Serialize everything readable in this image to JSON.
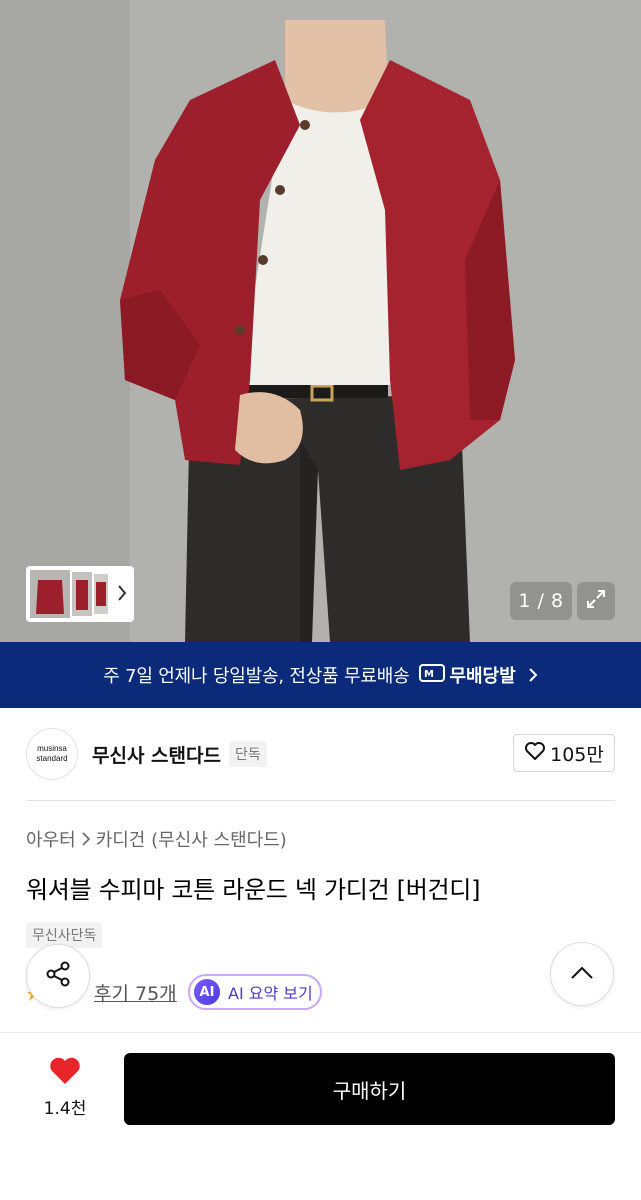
{
  "gallery": {
    "counter": "1 / 8",
    "thumbnail_strip": "product-thumbnails",
    "expand_icon": "expand-icon",
    "chevron_icon": "chevron-right-icon"
  },
  "banner": {
    "text": "주 7일 언제나 당일발송, 전상품 무료배송",
    "badge_label": "무배당발",
    "badge_icon": "delivery-badge-icon",
    "chevron_icon": "chevron-right-icon",
    "background_color": "#0b2a7a"
  },
  "brand": {
    "logo_line1": "musinsa",
    "logo_line2": "standard",
    "name": "무신사 스탠다드",
    "tag": "단독",
    "like_count": "105만",
    "like_icon": "heart-outline-icon"
  },
  "product": {
    "breadcrumb": [
      "아우터",
      "카디건 (무신사 스탠다드)"
    ],
    "title": "워셔블 수피마 코튼 라운드 넥 가디건 [버건디]",
    "tag": "무신사단독",
    "reviews_label": "후기 75개",
    "ai_badge": "AI",
    "ai_summary_label": "AI 요약 보기"
  },
  "floating": {
    "share_icon": "share-icon",
    "scroll_top_icon": "chevron-up-icon"
  },
  "bottom_bar": {
    "wish_icon": "heart-filled-icon",
    "wish_count": "1.4천",
    "buy_label": "구매하기",
    "accent_color": "#e8262a"
  }
}
